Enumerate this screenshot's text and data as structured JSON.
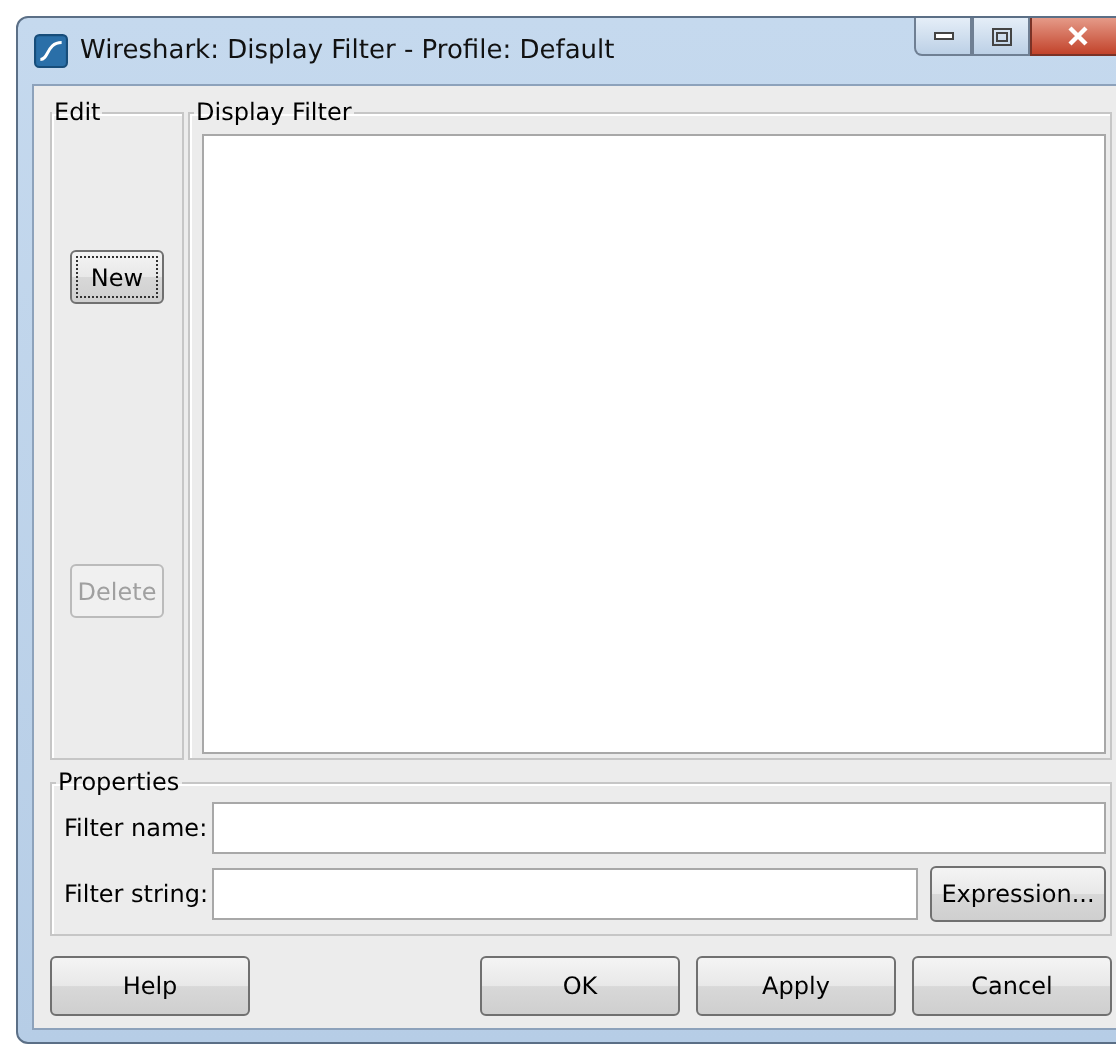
{
  "window": {
    "title": "Wireshark: Display Filter - Profile: Default"
  },
  "edit": {
    "label": "Edit",
    "buttons": [
      {
        "label": "New",
        "disabled": false,
        "focused": true
      },
      {
        "label": "Delete",
        "disabled": true,
        "focused": false
      }
    ]
  },
  "display_filter": {
    "label": "Display Filter"
  },
  "properties": {
    "label": "Properties",
    "fields": [
      {
        "label": "Filter name:"
      },
      {
        "label": "Filter string:",
        "button": "Expression..."
      }
    ]
  },
  "buttons": [
    {
      "label": "Help",
      "kind": "left"
    },
    {
      "label": "OK",
      "kind": "right"
    },
    {
      "label": "Apply",
      "kind": "right"
    },
    {
      "label": "Cancel",
      "kind": "right"
    }
  ]
}
